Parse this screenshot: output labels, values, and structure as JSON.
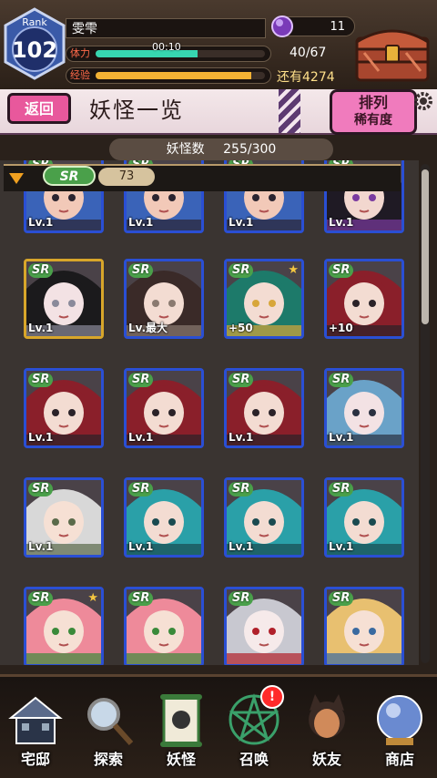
{
  "status": {
    "rank_label": "Rank",
    "rank_value": "102",
    "player_name": "雯雫",
    "gem_count": "11",
    "stamina_label": "体力",
    "stamina_timer": "00:10",
    "stamina_value": "40/67",
    "stamina_fraction": 0.6,
    "exp_label": "经验",
    "exp_value": "还有4274",
    "exp_fraction": 0.92
  },
  "header": {
    "back_label": "返回",
    "title": "妖怪一览",
    "sort_title": "排列",
    "sort_value": "稀有度"
  },
  "count": {
    "label": "妖怪数",
    "value": "255/300"
  },
  "group": {
    "rarity": "SR",
    "count": "73"
  },
  "cards": [
    {
      "rarity": "SR",
      "level": "Lv.1",
      "palette": [
        "#3a63b8",
        "#f2c9b8",
        "#2b2430"
      ],
      "frame": "blue"
    },
    {
      "rarity": "SR",
      "level": "Lv.1",
      "palette": [
        "#3a63b8",
        "#f2c9b8",
        "#2b2430"
      ],
      "frame": "blue"
    },
    {
      "rarity": "SR",
      "level": "Lv.1",
      "palette": [
        "#3a63b8",
        "#f2c9b8",
        "#2b2430"
      ],
      "frame": "blue"
    },
    {
      "rarity": "SR",
      "level": "Lv.1",
      "palette": [
        "#1f1a24",
        "#f2d7cf",
        "#7a3aa0"
      ],
      "frame": "blue"
    },
    {
      "rarity": "SR",
      "level": "Lv.1",
      "palette": [
        "#1b1a1c",
        "#f3e2e4",
        "#8a8a9a"
      ],
      "frame": "gold"
    },
    {
      "rarity": "SR",
      "level": "Lv.最大",
      "palette": [
        "#3a2a28",
        "#f3dcd2",
        "#8a7a70"
      ],
      "frame": "blue"
    },
    {
      "rarity": "SR",
      "level": "+50",
      "palette": [
        "#1d7a6a",
        "#f3dcd2",
        "#d7a63a"
      ],
      "frame": "blue",
      "star": true
    },
    {
      "rarity": "SR",
      "level": "+10",
      "palette": [
        "#8a1f2a",
        "#f3dcd2",
        "#2a2228"
      ],
      "frame": "blue"
    },
    {
      "rarity": "SR",
      "level": "Lv.1",
      "palette": [
        "#8a1f2a",
        "#f3dcd2",
        "#2a2228"
      ],
      "frame": "blue"
    },
    {
      "rarity": "SR",
      "level": "Lv.1",
      "palette": [
        "#8a1f2a",
        "#f3dcd2",
        "#2a2228"
      ],
      "frame": "blue"
    },
    {
      "rarity": "SR",
      "level": "Lv.1",
      "palette": [
        "#8a1f2a",
        "#f3dcd2",
        "#2a2228"
      ],
      "frame": "blue"
    },
    {
      "rarity": "SR",
      "level": "Lv.1",
      "palette": [
        "#6aa2c8",
        "#f3e2e4",
        "#2a3040"
      ],
      "frame": "blue"
    },
    {
      "rarity": "SR",
      "level": "Lv.1",
      "palette": [
        "#d8d8d8",
        "#f6e0d4",
        "#5a6a4a"
      ],
      "frame": "blue"
    },
    {
      "rarity": "SR",
      "level": "Lv.1",
      "palette": [
        "#2aa0a8",
        "#f3dcd2",
        "#1a4a50"
      ],
      "frame": "blue"
    },
    {
      "rarity": "SR",
      "level": "Lv.1",
      "palette": [
        "#2aa0a8",
        "#f3dcd2",
        "#1a4a50"
      ],
      "frame": "blue"
    },
    {
      "rarity": "SR",
      "level": "Lv.1",
      "palette": [
        "#2aa0a8",
        "#f3dcd2",
        "#1a4a50"
      ],
      "frame": "blue"
    },
    {
      "rarity": "SR",
      "level": "",
      "palette": [
        "#ee8a9a",
        "#f6e0d4",
        "#3a8a3a"
      ],
      "frame": "blue",
      "star": true
    },
    {
      "rarity": "SR",
      "level": "",
      "palette": [
        "#ee8a9a",
        "#f6e0d4",
        "#3a8a3a"
      ],
      "frame": "blue"
    },
    {
      "rarity": "SR",
      "level": "",
      "palette": [
        "#c8c8d0",
        "#f6eaea",
        "#b0202a"
      ],
      "frame": "blue"
    },
    {
      "rarity": "SR",
      "level": "",
      "palette": [
        "#e8c070",
        "#f6e0d4",
        "#3a6aa0"
      ],
      "frame": "blue"
    }
  ],
  "nav": [
    {
      "label": "宅邸",
      "icon": "house-icon",
      "color": "#5a6a8a"
    },
    {
      "label": "探索",
      "icon": "magnifier-icon",
      "color": "#8a8a8a"
    },
    {
      "label": "妖怪",
      "icon": "scroll-icon",
      "color": "#3a7a3a"
    },
    {
      "label": "召唤",
      "icon": "pentagram-icon",
      "color": "#3aa06a"
    },
    {
      "label": "妖友",
      "icon": "catgirl-icon",
      "color": "#d08a5a"
    },
    {
      "label": "商店",
      "icon": "crystal-ball-icon",
      "color": "#6a8ad0"
    }
  ],
  "summon_alert": "!",
  "colors": {
    "stamina": "#37d6b0",
    "exp": "#f3b234",
    "accent_pink": "#e8589c"
  }
}
